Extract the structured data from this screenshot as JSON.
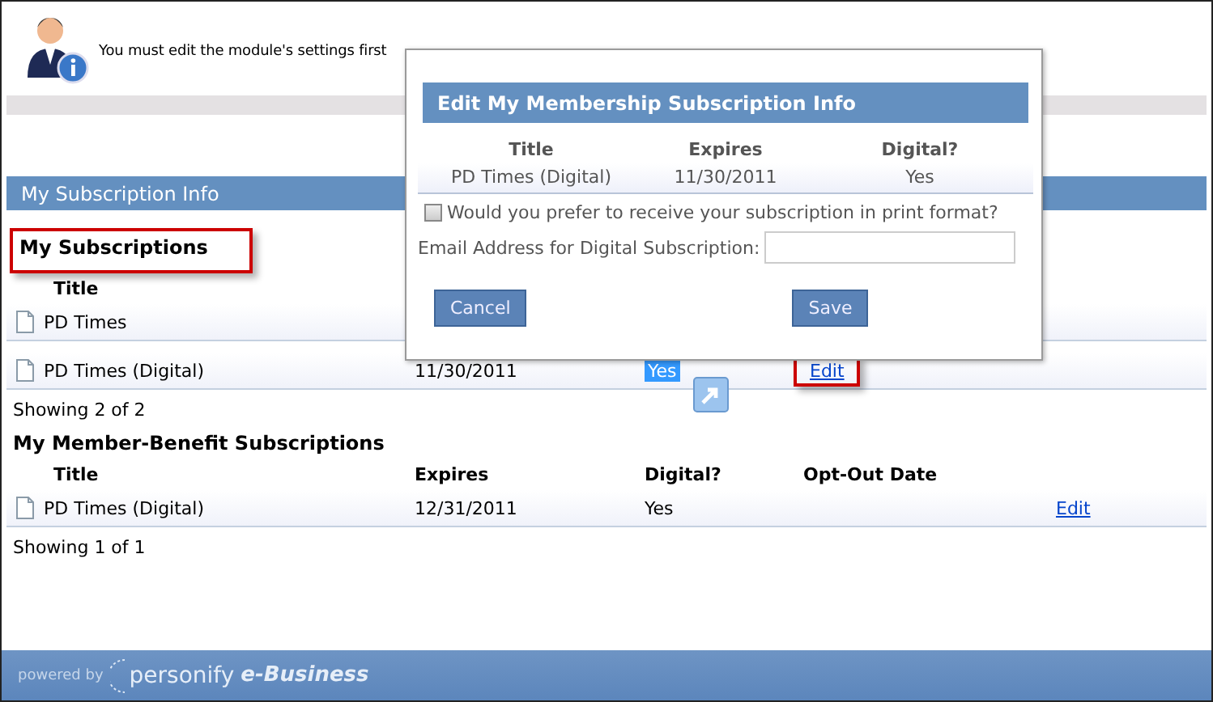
{
  "message": "You must edit the module's settings first",
  "section_header": "My Subscription Info",
  "subscriptions": {
    "heading": "My Subscriptions",
    "columns": [
      "Title"
    ],
    "rows": [
      {
        "title": "PD Times"
      },
      {
        "title": "PD Times (Digital)",
        "expires": "11/30/2011",
        "digital": "Yes",
        "digital_highlighted": true,
        "action": "Edit"
      }
    ],
    "count": "Showing 2 of 2"
  },
  "benefits": {
    "heading": "My Member-Benefit Subscriptions",
    "columns": [
      "Title",
      "Expires",
      "Digital?",
      "Opt-Out Date"
    ],
    "rows": [
      {
        "title": "PD Times (Digital)",
        "expires": "12/31/2011",
        "digital": "Yes",
        "action": "Edit"
      }
    ],
    "count": "Showing 1 of 1"
  },
  "dialog": {
    "title": "Edit My Membership Subscription Info",
    "columns": [
      "Title",
      "Expires",
      "Digital?"
    ],
    "row": [
      "PD Times (Digital)",
      "11/30/2011",
      "Yes"
    ],
    "print_option": {
      "label": "Would you prefer to receive your subscription in print format?",
      "checked": false
    },
    "email_label": "Email Address for Digital Subscription:",
    "buttons": [
      "Cancel",
      "Save"
    ]
  },
  "footer": {
    "powered_by": "powered by",
    "brand": "personify",
    "product": "e-Business"
  }
}
